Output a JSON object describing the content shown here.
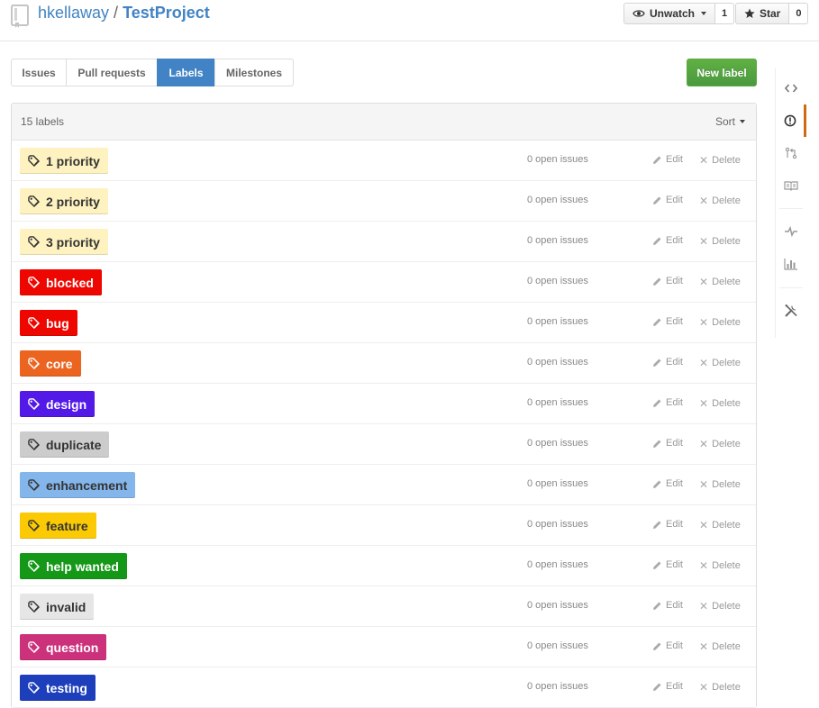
{
  "header": {
    "owner": "hkellaway",
    "separator": "/",
    "repo": "TestProject",
    "watch": {
      "label": "Unwatch",
      "count": "1"
    },
    "star": {
      "label": "Star",
      "count": "0"
    }
  },
  "subnav": {
    "tabs": [
      {
        "label": "Issues",
        "selected": false
      },
      {
        "label": "Pull requests",
        "selected": false
      },
      {
        "label": "Labels",
        "selected": true
      },
      {
        "label": "Milestones",
        "selected": false
      }
    ],
    "new_label": "New label"
  },
  "labels_table": {
    "count_text": "15 labels",
    "sort_label": "Sort",
    "open_issues_text": "0 open issues",
    "edit_label": "Edit",
    "delete_label": "Delete",
    "labels": [
      {
        "name": "1 priority",
        "bg": "#fef2c0",
        "fg": "#333333"
      },
      {
        "name": "2 priority",
        "bg": "#fef2c0",
        "fg": "#333333"
      },
      {
        "name": "3 priority",
        "bg": "#fef2c0",
        "fg": "#333333"
      },
      {
        "name": "blocked",
        "bg": "#ee0701",
        "fg": "#ffffff"
      },
      {
        "name": "bug",
        "bg": "#ee0701",
        "fg": "#ffffff"
      },
      {
        "name": "core",
        "bg": "#eb6420",
        "fg": "#ffffff"
      },
      {
        "name": "design",
        "bg": "#5319e7",
        "fg": "#ffffff"
      },
      {
        "name": "duplicate",
        "bg": "#cccccc",
        "fg": "#333333"
      },
      {
        "name": "enhancement",
        "bg": "#84b6eb",
        "fg": "#333333"
      },
      {
        "name": "feature",
        "bg": "#fbca04",
        "fg": "#333333"
      },
      {
        "name": "help wanted",
        "bg": "#159818",
        "fg": "#ffffff"
      },
      {
        "name": "invalid",
        "bg": "#e6e6e6",
        "fg": "#333333"
      },
      {
        "name": "question",
        "bg": "#cc317c",
        "fg": "#ffffff"
      },
      {
        "name": "testing",
        "bg": "#1d3fbb",
        "fg": "#ffffff"
      }
    ]
  },
  "repo_nav": {
    "items": [
      {
        "icon": "code-icon",
        "selected": false
      },
      {
        "icon": "issue-icon",
        "selected": true
      },
      {
        "icon": "pull-request-icon",
        "selected": false
      },
      {
        "icon": "wiki-book-icon",
        "selected": false
      },
      {
        "icon": "pulse-icon",
        "selected": false
      },
      {
        "icon": "graph-icon",
        "selected": false
      },
      {
        "icon": "settings-tools-icon",
        "selected": false
      }
    ]
  },
  "colors": {
    "link": "#4183c4",
    "selected_tab": "#4183c4",
    "new_label_button": "#60b044",
    "nav_selected": "#d26911"
  }
}
